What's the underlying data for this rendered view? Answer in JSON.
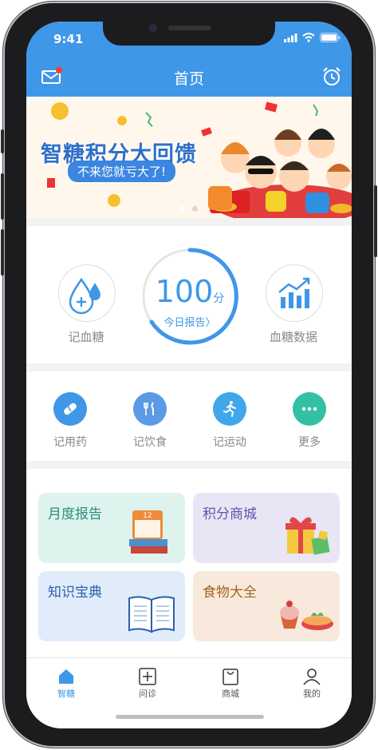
{
  "status_bar": {
    "time": "9:41"
  },
  "navbar": {
    "title": "首页",
    "left_icon": "mail-icon",
    "right_icon": "alarm-clock-icon"
  },
  "banner": {
    "headline": "智糖积分大回馈",
    "subline": "不来您就亏大了!"
  },
  "main_actions": {
    "blood_sugar_label": "记血糖",
    "score_value": "100",
    "score_unit": "分",
    "today_report": "今日报告〉",
    "blood_sugar_data_label": "血糖数据"
  },
  "quick_actions": [
    {
      "label": "记用药",
      "icon": "pill-icon",
      "color": "#3f97e8"
    },
    {
      "label": "记饮食",
      "icon": "fork-knife-icon",
      "color": "#5a9ae6"
    },
    {
      "label": "记运动",
      "icon": "running-icon",
      "color": "#3fa7ea"
    },
    {
      "label": "更多",
      "icon": "more-icon",
      "color": "#34c0a3"
    }
  ],
  "tiles": [
    {
      "title": "月度报告",
      "bg": "#def2ee",
      "color": "#2b8f7c",
      "calendar_day": "12"
    },
    {
      "title": "积分商城",
      "bg": "#e8e6f4",
      "color": "#6a4fb0"
    },
    {
      "title": "知识宝典",
      "bg": "#e1ecfb",
      "color": "#2f5fa8"
    },
    {
      "title": "食物大全",
      "bg": "#f8e9dc",
      "color": "#a2651f"
    }
  ],
  "tabbar": [
    {
      "label": "智糖",
      "active": true
    },
    {
      "label": "问诊",
      "active": false
    },
    {
      "label": "商城",
      "active": false
    },
    {
      "label": "我的",
      "active": false
    }
  ],
  "colors": {
    "primary": "#3f97e8",
    "active_tab": "#3f97e8"
  }
}
